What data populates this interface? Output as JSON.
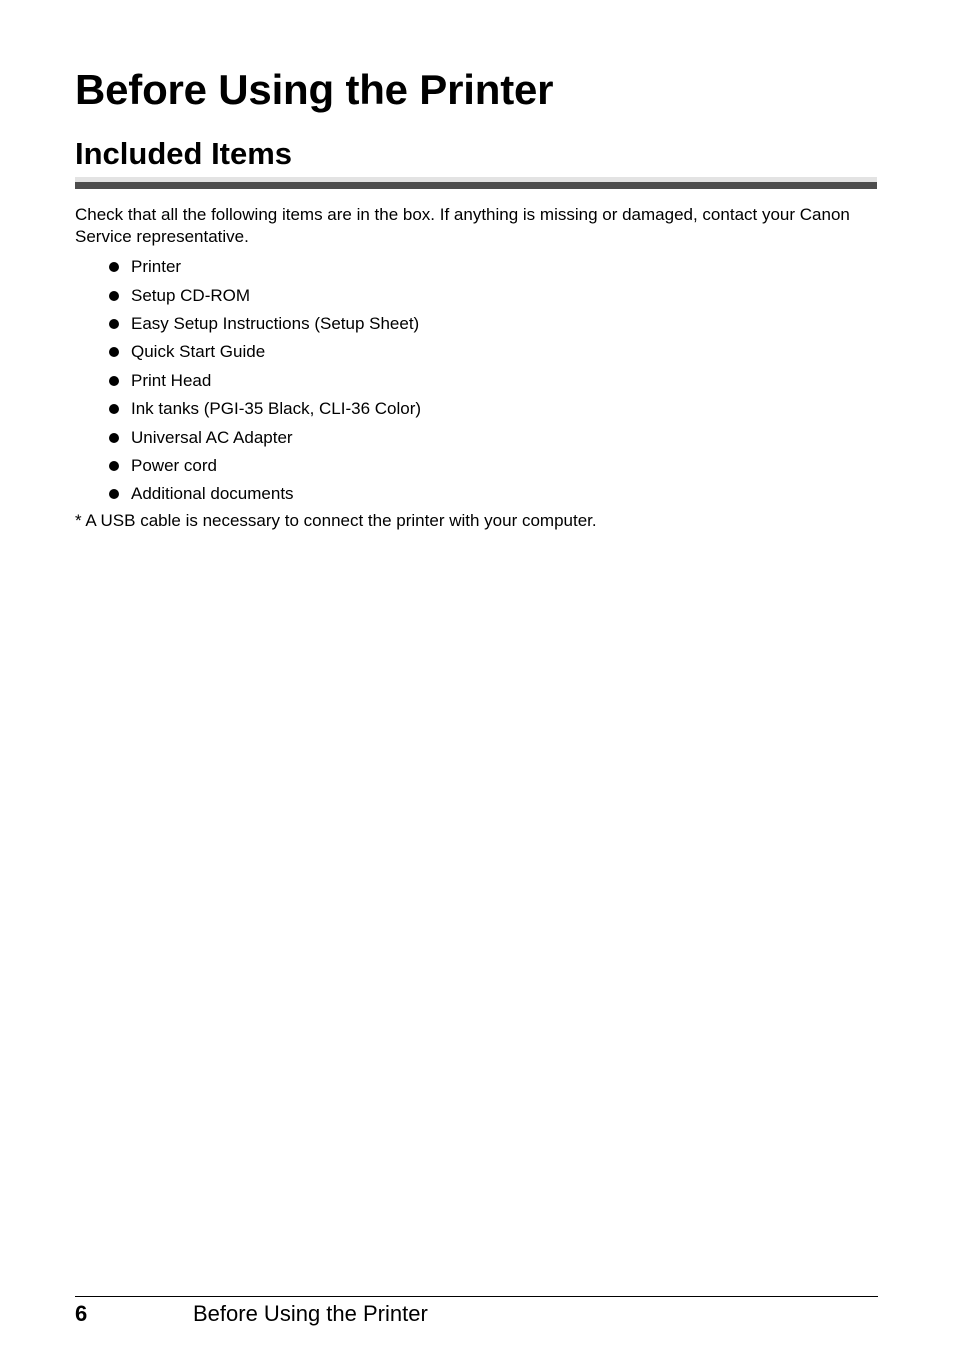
{
  "page": {
    "title": "Before Using the Printer",
    "section_title": "Included Items",
    "intro": "Check that all the following items are in the box. If anything is missing or damaged, contact your Canon Service representative.",
    "items": [
      "Printer",
      "Setup CD-ROM",
      "Easy Setup Instructions (Setup Sheet)",
      "Quick Start Guide",
      "Print Head",
      "Ink tanks (PGI-35 Black, CLI-36 Color)",
      "Universal AC Adapter",
      "Power cord",
      "Additional documents"
    ],
    "note": "* A USB cable is necessary to connect the printer with your computer."
  },
  "footer": {
    "page_number": "6",
    "title": "Before Using the Printer"
  }
}
